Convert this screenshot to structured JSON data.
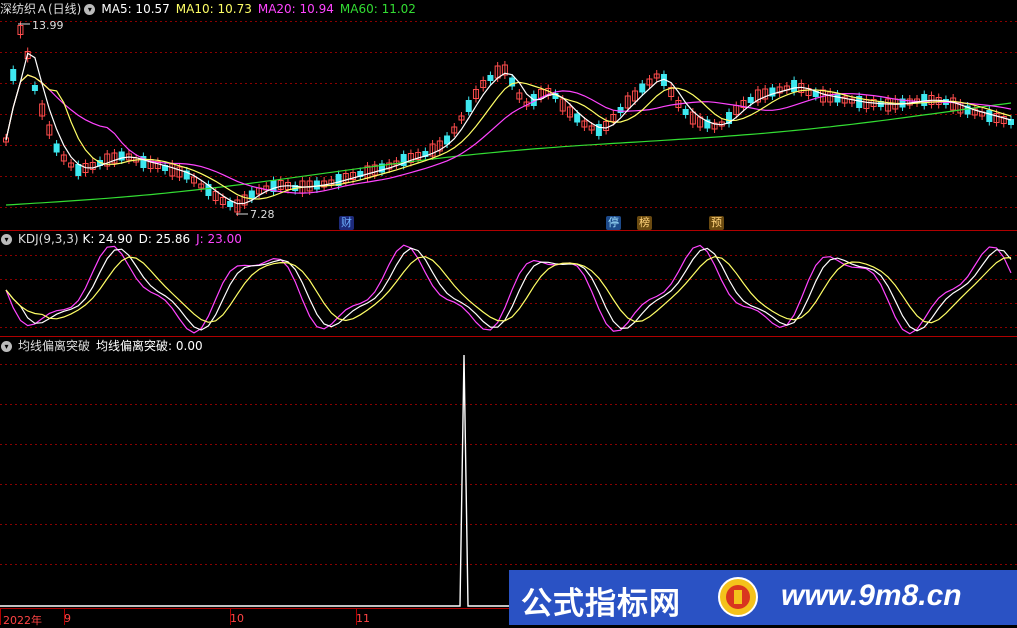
{
  "stock": {
    "name": "深纺织Ａ(日线)",
    "ma5_label": "MA5: 10.57",
    "ma10_label": "MA10: 10.73",
    "ma20_label": "MA20: 10.94",
    "ma60_label": "MA60: 11.02",
    "high_label": "13.99",
    "low_label": "7.28"
  },
  "kdj": {
    "name": "KDJ(9,3,3)",
    "k_label": "K: 24.90",
    "d_label": "D: 25.86",
    "j_label": "J: 23.00"
  },
  "indicator": {
    "name": "均线偏离突破",
    "value_label": "均线偏离突破: 0.00"
  },
  "badges": [
    "财",
    "停",
    "榜",
    "预"
  ],
  "x_axis": [
    "2022年",
    "9",
    "10",
    "11"
  ],
  "watermark": {
    "text1": "公式指标网",
    "text2": "www.9m8.cn"
  },
  "colors": {
    "up": "#ff4d4d",
    "down": "#3ee8f0",
    "ma5": "#ffffff",
    "ma10": "#ffff66",
    "ma20": "#ff44ff",
    "ma60": "#33dd33",
    "grid": "#8a0000",
    "border": "#b00000"
  },
  "chart_data": [
    {
      "type": "line",
      "name_ref": "stock.name",
      "series": [
        {
          "name": "MA5",
          "values": []
        },
        {
          "name": "MA10",
          "values": []
        },
        {
          "name": "MA20",
          "values": []
        },
        {
          "name": "MA60",
          "values": []
        }
      ],
      "ylim": [
        7.28,
        13.99
      ]
    },
    {
      "type": "line",
      "name_ref": "kdj.name",
      "series": [
        {
          "name": "K",
          "values": []
        },
        {
          "name": "D",
          "values": []
        },
        {
          "name": "J",
          "values": []
        }
      ]
    },
    {
      "type": "line",
      "name_ref": "indicator.name",
      "series": [
        {
          "name": "均线偏离突破",
          "values": []
        }
      ]
    }
  ]
}
